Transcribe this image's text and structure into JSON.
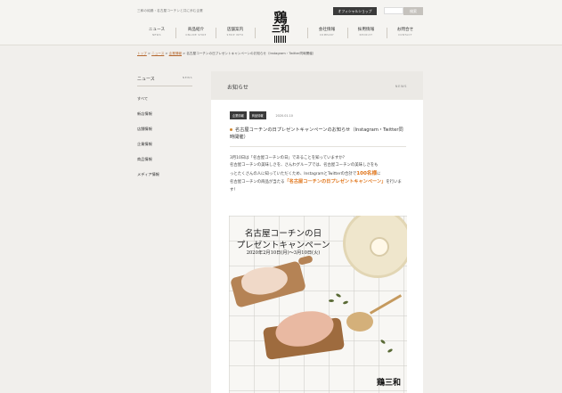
{
  "header": {
    "tagline": "三和の純鶏・名古屋コーチンと共に歩む企業",
    "official_shop": "オフィシャルショップ",
    "search_placeholder": "",
    "search_button": "検索",
    "logo_kanji_top": "鶏",
    "logo_kanji_bottom": "三和",
    "nav": [
      {
        "jp": "ニュース",
        "en": "NEWS"
      },
      {
        "jp": "商品紹介",
        "en": "ONLINE SHOP"
      },
      {
        "jp": "店舗案内",
        "en": "SHOP INFO"
      },
      {
        "jp": "会社情報",
        "en": "COMPANY"
      },
      {
        "jp": "採用情報",
        "en": "RECRUIT"
      },
      {
        "jp": "お問合せ",
        "en": "CONTACT"
      }
    ]
  },
  "breadcrumb": {
    "home": "トップ",
    "news": "ニュース",
    "category": "企業情報",
    "current": "名古屋コーチンの日プレゼントキャンペーンのお知らせ（Instagram・Twitter同時開催）",
    "sep": ">"
  },
  "sidebar": {
    "title": "ニュース",
    "title_en": "NEWS",
    "items": [
      "すべて",
      "新店情報",
      "店舗情報",
      "企業情報",
      "商品情報",
      "メディア情報"
    ]
  },
  "main": {
    "title": "お知らせ",
    "title_en": "NEWS",
    "categories": [
      "企業情報",
      "商品情報"
    ],
    "date": "2020.01.10",
    "post_title": "名古屋コーチンの日プレゼントキャンペーンのお知らせ（Instagram・Twitter同時開催）",
    "body_1": "3月10日は「名古屋コーチンの日」であることを知っていますか？",
    "body_2": "名古屋コーチンの美味しさを、さんわグループでは、名古屋コーチンの美味しさをも",
    "body_3": "っとたくさんの人に知っていただくため、InstagramとTwitterの合計で",
    "count_highlight": "100名様",
    "body_4": "に",
    "body_5": "名古屋コーチンの商品が当たる",
    "campaign_highlight": "「名古屋コーチンの日プレゼントキャンペーン」",
    "body_6": "を行います！"
  },
  "promo": {
    "line1": "名古屋コーチンの日",
    "line2": "プレゼントキャンペーン",
    "dates": "2020年2月10日(月)～3月10日(火)",
    "logo": "鶏三和"
  }
}
